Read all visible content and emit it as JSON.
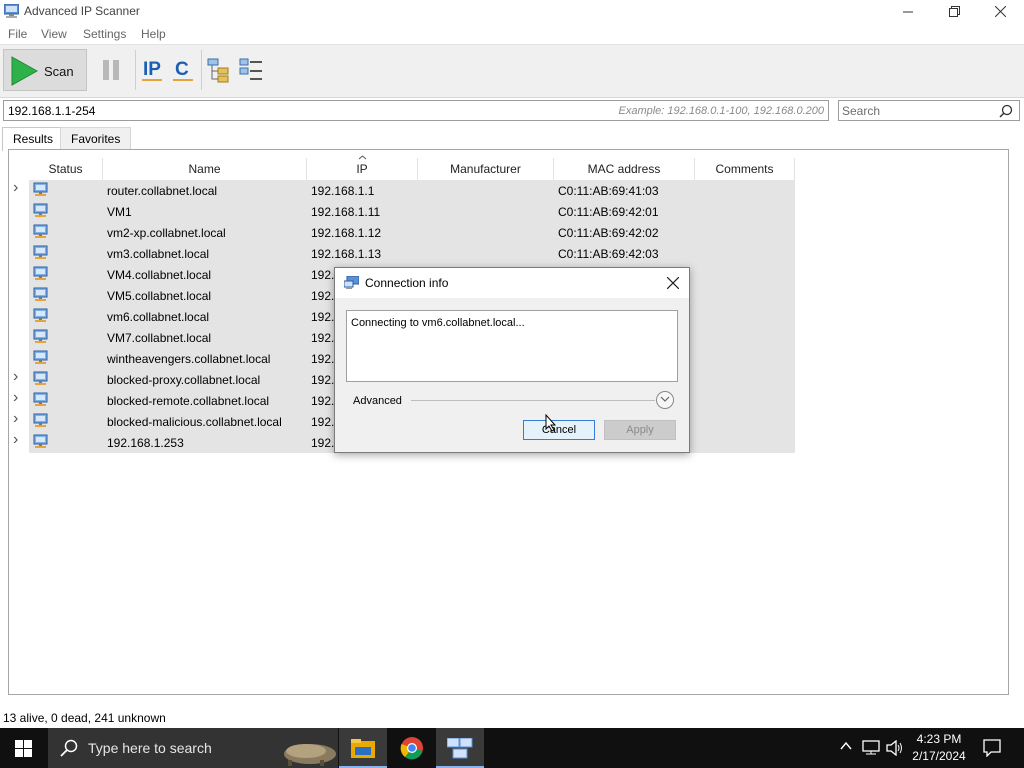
{
  "window": {
    "title": "Advanced IP Scanner",
    "controls": {
      "minimize": "minimize-icon",
      "restore": "restore-icon",
      "close": "close-icon"
    }
  },
  "menu": [
    "File",
    "View",
    "Settings",
    "Help"
  ],
  "toolbar": {
    "scan_label": "Scan",
    "icons": [
      "play-icon",
      "pause-icon",
      "ip-icon",
      "c-icon",
      "expand-all-icon",
      "collapse-all-icon"
    ]
  },
  "ip_range": {
    "value": "192.168.1.1-254",
    "example": "Example: 192.168.0.1-100, 192.168.0.200"
  },
  "search": {
    "placeholder": "Search"
  },
  "tabs": [
    "Results",
    "Favorites"
  ],
  "table": {
    "columns": [
      "Status",
      "Name",
      "IP",
      "Manufacturer",
      "MAC address",
      "Comments"
    ],
    "rows": [
      {
        "name": "router.collabnet.local",
        "ip": "192.168.1.1",
        "mac": "C0:11:AB:69:41:03",
        "expandable": true
      },
      {
        "name": "VM1",
        "ip": "192.168.1.11",
        "mac": "C0:11:AB:69:42:01",
        "expandable": false
      },
      {
        "name": "vm2-xp.collabnet.local",
        "ip": "192.168.1.12",
        "mac": "C0:11:AB:69:42:02",
        "expandable": false
      },
      {
        "name": "vm3.collabnet.local",
        "ip": "192.168.1.13",
        "mac": "C0:11:AB:69:42:03",
        "expandable": false
      },
      {
        "name": "VM4.collabnet.local",
        "ip": "192.1",
        "mac": "",
        "expandable": false
      },
      {
        "name": "VM5.collabnet.local",
        "ip": "192.1",
        "mac": "",
        "expandable": false
      },
      {
        "name": "vm6.collabnet.local",
        "ip": "192.1",
        "mac": "",
        "expandable": false
      },
      {
        "name": "VM7.collabnet.local",
        "ip": "192.1",
        "mac": "",
        "expandable": false
      },
      {
        "name": "wintheavengers.collabnet.local",
        "ip": "192.1",
        "mac": "",
        "expandable": false
      },
      {
        "name": "blocked-proxy.collabnet.local",
        "ip": "192.1",
        "mac": "",
        "expandable": true
      },
      {
        "name": "blocked-remote.collabnet.local",
        "ip": "192.1",
        "mac": "",
        "expandable": true
      },
      {
        "name": "blocked-malicious.collabnet.local",
        "ip": "192.1",
        "mac": "",
        "expandable": true
      },
      {
        "name": "192.168.1.253",
        "ip": "192.1",
        "mac": "",
        "expandable": true
      }
    ]
  },
  "dialog": {
    "title": "Connection info",
    "message": "Connecting to vm6.collabnet.local...",
    "advanced_label": "Advanced",
    "cancel_label": "Cancel",
    "apply_label": "Apply"
  },
  "status": "13 alive, 0 dead, 241 unknown",
  "taskbar": {
    "search_placeholder": "Type here to search",
    "apps": [
      "file-explorer-icon",
      "chrome-icon",
      "advanced-ip-scanner-icon"
    ],
    "time": "4:23 PM",
    "date": "2/17/2024"
  },
  "colors": {
    "scan_green": "#2fb14a",
    "ip_blue": "#1a5fb4",
    "row_bg": "#e4e4e4",
    "taskbar": "#101010"
  }
}
